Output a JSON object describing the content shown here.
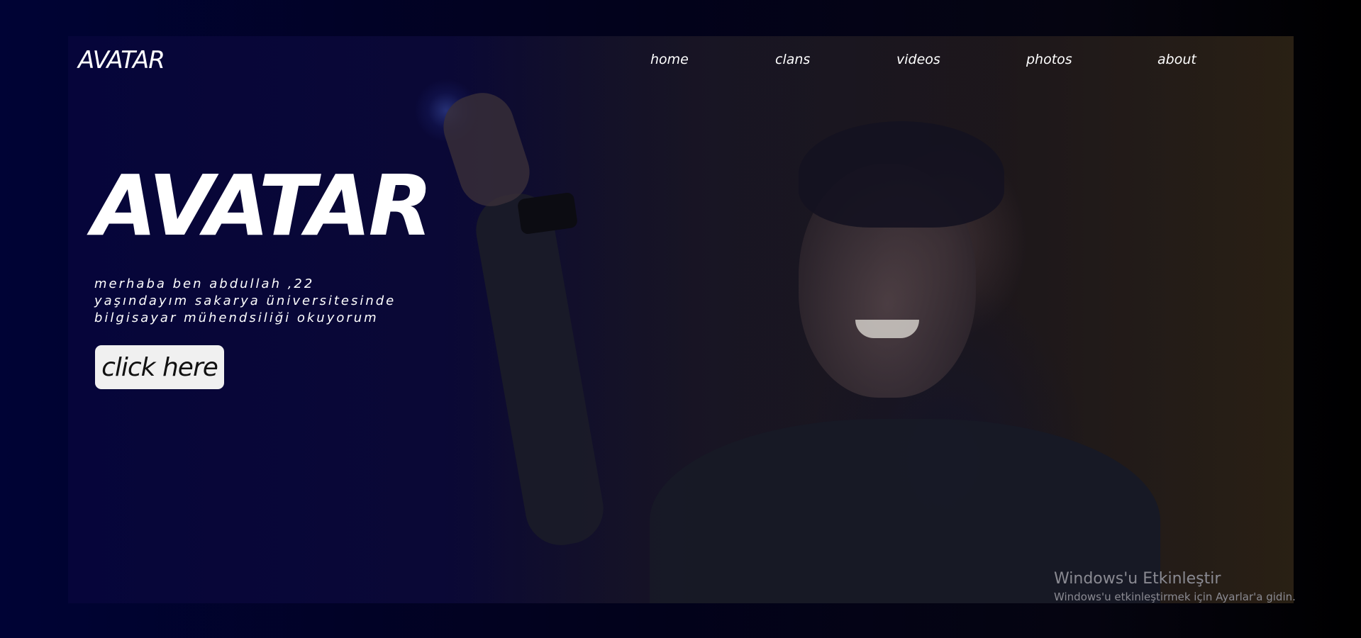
{
  "header": {
    "logo": "AVATAR",
    "nav": [
      {
        "label": "home"
      },
      {
        "label": "clans"
      },
      {
        "label": "videos"
      },
      {
        "label": "photos"
      },
      {
        "label": "about"
      }
    ]
  },
  "hero": {
    "title": "AVATAR",
    "intro_lines": [
      "merhaba ben abdullah ,22",
      "yaşındayım sakarya üniversitesinde",
      "bilgisayar mühendsiliği okuyorum"
    ],
    "cta_label": "click here"
  },
  "watermark": {
    "title": "Windows'u Etkinleştir",
    "subtitle": "Windows'u etkinleştirmek için Ayarlar'a gidin."
  },
  "colors": {
    "background": "#03031a",
    "hero_left": "#06053a",
    "hero_right": "#2a2114",
    "text": "#ffffff",
    "button_bg": "#f0f0f0"
  }
}
